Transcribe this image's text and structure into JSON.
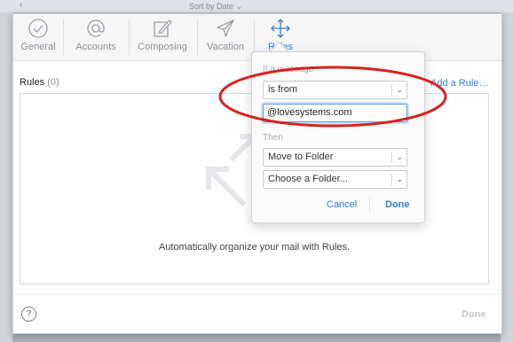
{
  "window": {
    "back_glyph": "‹",
    "sort_label": "Sort by Date ⌄"
  },
  "toolbar": {
    "tabs": [
      {
        "label": "General",
        "icon": "checkmark-circle-icon"
      },
      {
        "label": "Accounts",
        "icon": "at-sign-icon"
      },
      {
        "label": "Composing",
        "icon": "pencil-square-icon"
      },
      {
        "label": "Vacation",
        "icon": "airplane-icon"
      },
      {
        "label": "Rules",
        "icon": "move-arrows-icon",
        "active": true
      }
    ]
  },
  "rules_panel": {
    "title": "Rules",
    "count": "(0)",
    "add_rule_label": "Add a Rule…",
    "empty_message": "Automatically organize your mail with Rules."
  },
  "popover": {
    "if_label": "If a message",
    "condition_select": "is from",
    "condition_value": "@lovesystems.com",
    "then_label": "Then",
    "action_select": "Move to Folder",
    "folder_select": "Choose a Folder...",
    "cancel_label": "Cancel",
    "done_label": "Done"
  },
  "footer": {
    "help_label": "?",
    "done_label": "Done"
  },
  "colors": {
    "accent": "#2f7fd6",
    "highlight_ring": "#d9221c"
  }
}
